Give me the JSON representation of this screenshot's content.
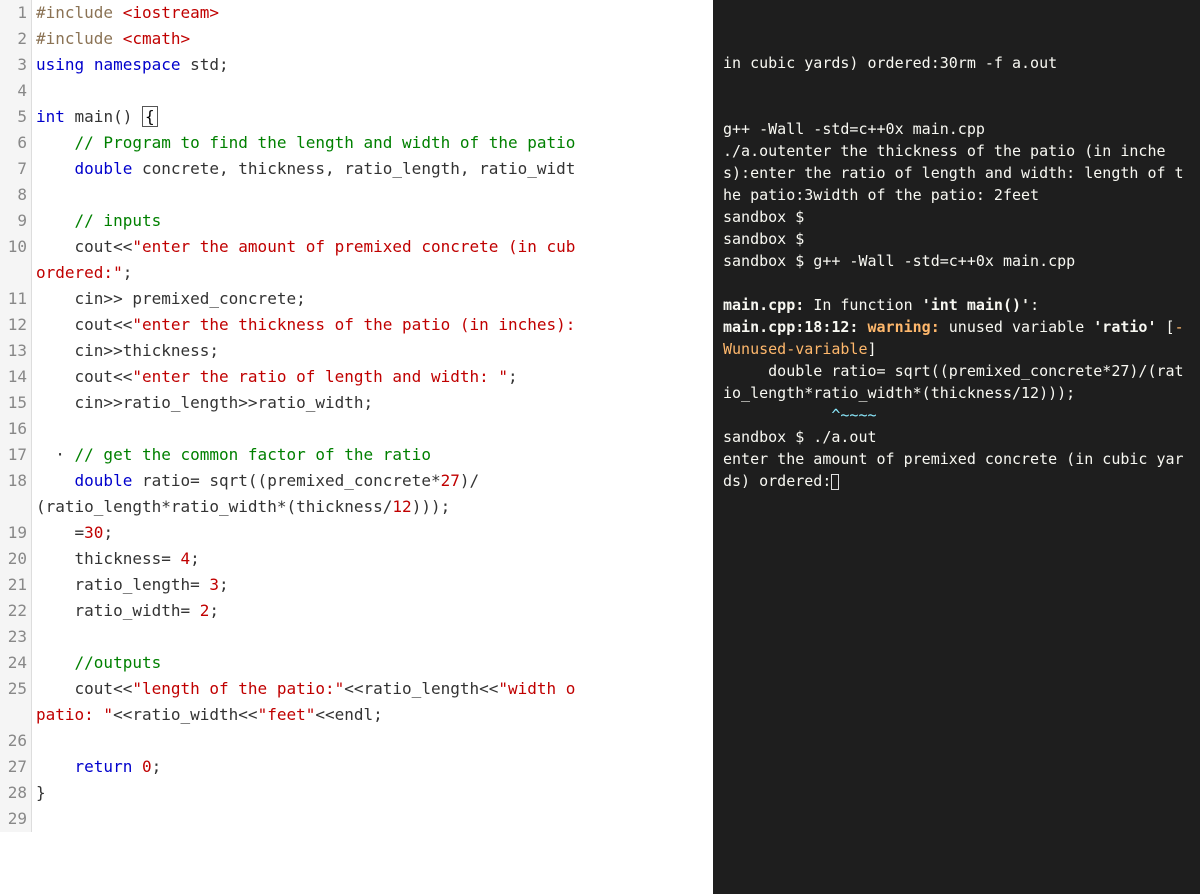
{
  "editor": {
    "lines": [
      {
        "num": "1",
        "tokens": [
          [
            "preproc",
            "#include"
          ],
          [
            "ident",
            " "
          ],
          [
            "string",
            "<iostream>"
          ]
        ]
      },
      {
        "num": "2",
        "tokens": [
          [
            "preproc",
            "#include"
          ],
          [
            "ident",
            " "
          ],
          [
            "string",
            "<cmath>"
          ]
        ]
      },
      {
        "num": "3",
        "tokens": [
          [
            "keyword",
            "using"
          ],
          [
            "ident",
            " "
          ],
          [
            "keyword",
            "namespace"
          ],
          [
            "ident",
            " std;"
          ]
        ]
      },
      {
        "num": "4",
        "tokens": []
      },
      {
        "num": "5",
        "tokens": [
          [
            "type",
            "int"
          ],
          [
            "ident",
            " main() "
          ],
          [
            "cursor",
            "{"
          ]
        ]
      },
      {
        "num": "6",
        "tokens": [
          [
            "ident",
            "    "
          ],
          [
            "comment",
            "// Program to find the length and width of the patio"
          ]
        ]
      },
      {
        "num": "7",
        "tokens": [
          [
            "ident",
            "    "
          ],
          [
            "type",
            "double"
          ],
          [
            "ident",
            " concrete, thickness, ratio_length, ratio_widt"
          ]
        ]
      },
      {
        "num": "8",
        "tokens": []
      },
      {
        "num": "9",
        "tokens": [
          [
            "ident",
            "    "
          ],
          [
            "comment",
            "// inputs"
          ]
        ]
      },
      {
        "num": "10",
        "tokens": [
          [
            "ident",
            "    cout<<"
          ],
          [
            "string",
            "\"enter the amount of premixed concrete (in cub"
          ]
        ]
      },
      {
        "num": "",
        "tokens": [
          [
            "string",
            "ordered:\""
          ],
          [
            "ident",
            ";"
          ]
        ],
        "wrap": true
      },
      {
        "num": "11",
        "tokens": [
          [
            "ident",
            "    cin>> premixed_concrete;"
          ]
        ]
      },
      {
        "num": "12",
        "tokens": [
          [
            "ident",
            "    cout<<"
          ],
          [
            "string",
            "\"enter the thickness of the patio (in inches):"
          ]
        ]
      },
      {
        "num": "13",
        "tokens": [
          [
            "ident",
            "    cin>>thickness;"
          ]
        ]
      },
      {
        "num": "14",
        "tokens": [
          [
            "ident",
            "    cout<<"
          ],
          [
            "string",
            "\"enter the ratio of length and width: \""
          ],
          [
            "ident",
            ";"
          ]
        ]
      },
      {
        "num": "15",
        "tokens": [
          [
            "ident",
            "    cin>>ratio_length>>ratio_width;"
          ]
        ]
      },
      {
        "num": "16",
        "tokens": []
      },
      {
        "num": "17",
        "tokens": [
          [
            "ident",
            "  · "
          ],
          [
            "comment",
            "// get the common factor of the ratio"
          ]
        ]
      },
      {
        "num": "18",
        "tokens": [
          [
            "ident",
            "    "
          ],
          [
            "type",
            "double"
          ],
          [
            "ident",
            " ratio= sqrt((premixed_concrete*"
          ],
          [
            "number",
            "27"
          ],
          [
            "ident",
            ")/"
          ]
        ]
      },
      {
        "num": "",
        "tokens": [
          [
            "ident",
            "(ratio_length*ratio_width*(thickness/"
          ],
          [
            "number",
            "12"
          ],
          [
            "ident",
            ")));"
          ]
        ],
        "wrap": true
      },
      {
        "num": "19",
        "tokens": [
          [
            "ident",
            "    ="
          ],
          [
            "number",
            "30"
          ],
          [
            "ident",
            ";"
          ]
        ]
      },
      {
        "num": "20",
        "tokens": [
          [
            "ident",
            "    thickness= "
          ],
          [
            "number",
            "4"
          ],
          [
            "ident",
            ";"
          ]
        ]
      },
      {
        "num": "21",
        "tokens": [
          [
            "ident",
            "    ratio_length= "
          ],
          [
            "number",
            "3"
          ],
          [
            "ident",
            ";"
          ]
        ]
      },
      {
        "num": "22",
        "tokens": [
          [
            "ident",
            "    ratio_width= "
          ],
          [
            "number",
            "2"
          ],
          [
            "ident",
            ";"
          ]
        ]
      },
      {
        "num": "23",
        "tokens": []
      },
      {
        "num": "24",
        "tokens": [
          [
            "ident",
            "    "
          ],
          [
            "comment",
            "//outputs"
          ]
        ]
      },
      {
        "num": "25",
        "tokens": [
          [
            "ident",
            "    cout<<"
          ],
          [
            "string",
            "\"length of the patio:\""
          ],
          [
            "ident",
            "<<ratio_length<<"
          ],
          [
            "string",
            "\"width o"
          ]
        ]
      },
      {
        "num": "",
        "tokens": [
          [
            "string",
            "patio: \""
          ],
          [
            "ident",
            "<<ratio_width<<"
          ],
          [
            "string",
            "\"feet\""
          ],
          [
            "ident",
            "<<endl;"
          ]
        ],
        "wrap": true
      },
      {
        "num": "26",
        "tokens": []
      },
      {
        "num": "27",
        "tokens": [
          [
            "ident",
            "    "
          ],
          [
            "keyword",
            "return"
          ],
          [
            "ident",
            " "
          ],
          [
            "number",
            "0"
          ],
          [
            "ident",
            ";"
          ]
        ]
      },
      {
        "num": "28",
        "tokens": [
          [
            "ident",
            "}"
          ]
        ]
      },
      {
        "num": "29",
        "tokens": []
      }
    ]
  },
  "terminal": {
    "segments": [
      [
        "t-white",
        "in cubic yards) ordered:30rm -f a.out\n\n\n"
      ],
      [
        "t-white",
        "g++ -Wall -std=c++0x main.cpp\n"
      ],
      [
        "t-white",
        "./a.outenter the thickness of the patio (in inches):enter the ratio of length and width: length of the patio:3width of the patio: 2feet\n"
      ],
      [
        "t-white",
        "sandbox $\n"
      ],
      [
        "t-white",
        "sandbox $\n"
      ],
      [
        "t-white",
        "sandbox $ g++ -Wall -std=c++0x main.cpp\n\n"
      ],
      [
        "t-white t-bold",
        "main.cpp: "
      ],
      [
        "t-white",
        "In function "
      ],
      [
        "t-white t-bold",
        "'int main()'"
      ],
      [
        "t-white",
        ":\n"
      ],
      [
        "t-white t-bold",
        "main.cpp:18:12: "
      ],
      [
        "t-orange t-bold",
        "warning: "
      ],
      [
        "t-white",
        "unused variable "
      ],
      [
        "t-white t-bold",
        "'ratio'"
      ],
      [
        "t-white",
        " ["
      ],
      [
        "t-orange",
        "-Wunused-variable"
      ],
      [
        "t-white",
        "]\n"
      ],
      [
        "t-white",
        "     double ratio= sqrt((premixed_concrete*27)/(ratio_length*ratio_width*(thickness/12)));\n"
      ],
      [
        "t-cyan",
        "            ^~~~~\n"
      ],
      [
        "t-white",
        "sandbox $ ./a.out\n"
      ],
      [
        "t-white",
        "enter the amount of premixed concrete (in cubic yards) ordered:"
      ]
    ]
  }
}
